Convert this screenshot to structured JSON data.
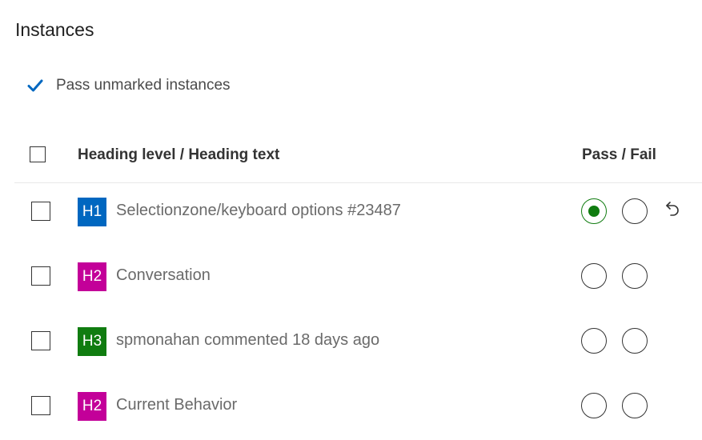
{
  "section": {
    "title": "Instances"
  },
  "pass_unmarked": {
    "label": "Pass unmarked instances",
    "checked": true,
    "check_color": "#0067c0"
  },
  "table": {
    "headers": {
      "heading": "Heading level / Heading text",
      "pass_fail": "Pass / Fail"
    },
    "rows": [
      {
        "level": "H1",
        "badge_color": "#0067c0",
        "text": "Selectionzone/keyboard options #23487",
        "status": "pass",
        "undo": true
      },
      {
        "level": "H2",
        "badge_color": "#c30099",
        "text": "Conversation",
        "status": "none",
        "undo": false
      },
      {
        "level": "H3",
        "badge_color": "#107c10",
        "text": "spmonahan commented 18 days ago",
        "status": "none",
        "undo": false
      },
      {
        "level": "H2",
        "badge_color": "#c30099",
        "text": "Current Behavior",
        "status": "none",
        "undo": false
      }
    ]
  },
  "icons": {
    "checkmark": "checkmark-icon",
    "undo": "undo-icon"
  },
  "colors": {
    "pass_selected": "#107c10"
  }
}
